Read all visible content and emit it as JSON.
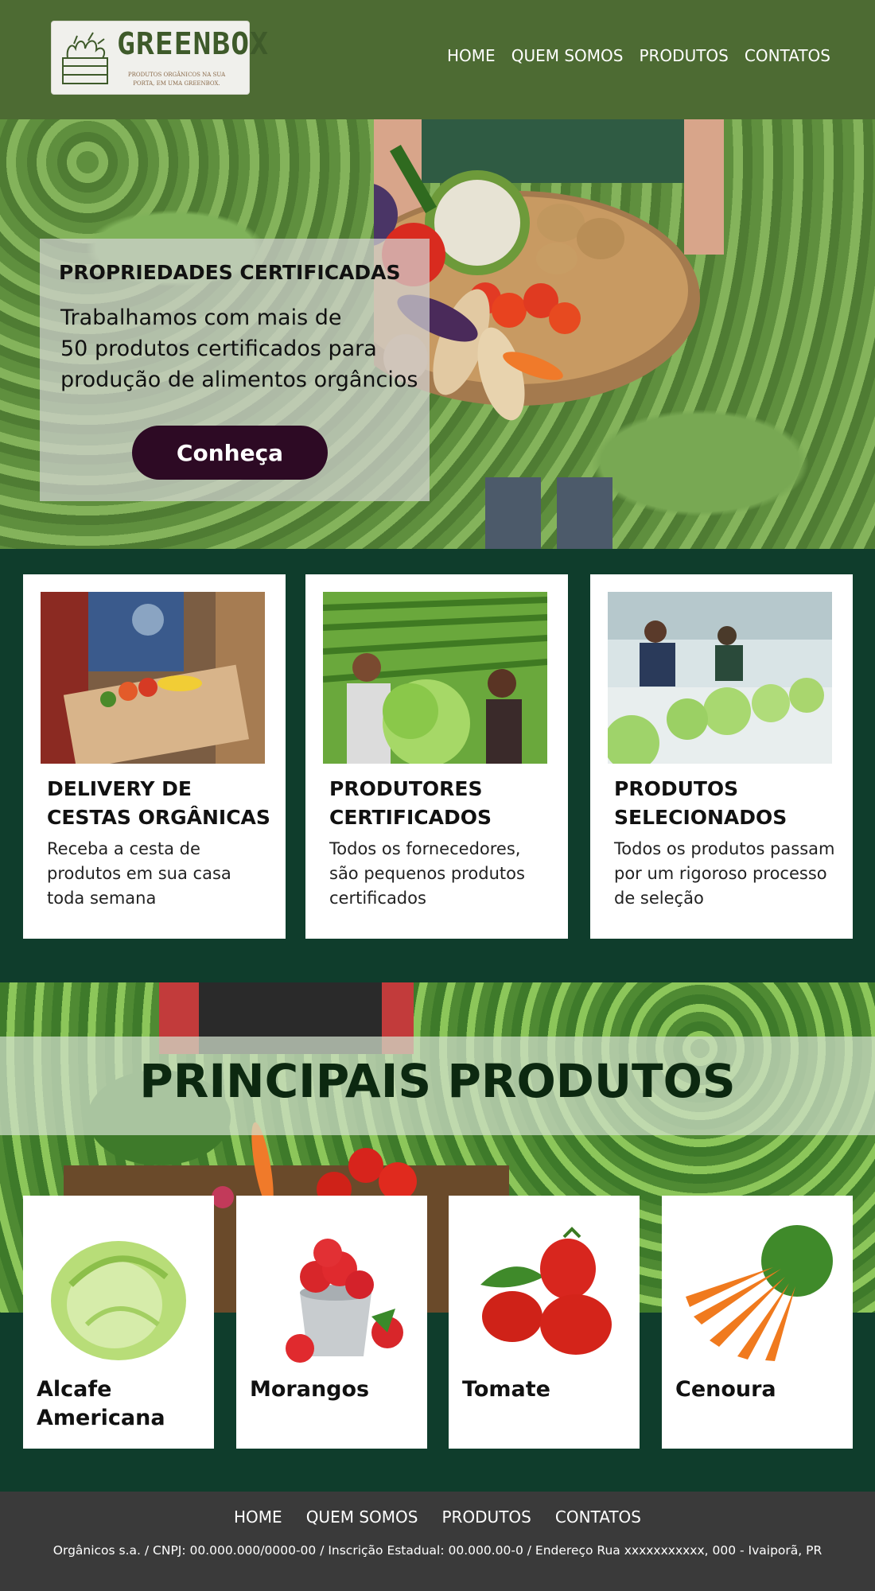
{
  "brand": {
    "name": "GREENBOX",
    "tagline": "PRODUTOS ORGÂNICOS NA SUA PORTA, EM UMA GREENBOX."
  },
  "nav": [
    "HOME",
    "QUEM SOMOS",
    "PRODUTOS",
    "CONTATOS"
  ],
  "hero": {
    "title": "PROPRIEDADES CERTIFICADAS",
    "line1": "Trabalhamos com mais de",
    "line2": "50 produtos certificados para",
    "line3": "produção de alimentos orgâncios",
    "button": "Conheça"
  },
  "features": [
    {
      "title": "DELIVERY DE CESTAS ORGÂNICAS",
      "text": "Receba a cesta de produtos em sua casa toda semana"
    },
    {
      "title": "PRODUTORES CERTIFICADOS",
      "text": "Todos os fornecedores, são pequenos produtos certificados"
    },
    {
      "title": "PRODUTOS SELECIONADOS",
      "text": "Todos os produtos passam por um rigoroso processo de seleção"
    }
  ],
  "products_section": {
    "title": "PRINCIPAIS PRODUTOS",
    "items": [
      "Alcafe Americana",
      "Morangos",
      "Tomate",
      "Cenoura"
    ]
  },
  "footer": {
    "nav": [
      "HOME",
      "QUEM SOMOS",
      "PRODUTOS",
      "CONTATOS"
    ],
    "info": "Orgânicos s.a. / CNPJ: 00.000.000/0000-00 / Inscrição Estadual: 00.000.00-0 / Endereço Rua xxxxxxxxxxx, 000 - Ivaiporã, PR"
  },
  "colors": {
    "header": "#4d6b33",
    "page_bg": "#0f3d2c",
    "button": "#2d0a24",
    "footer": "#3a3a3a",
    "section_title": "#0c2810"
  }
}
